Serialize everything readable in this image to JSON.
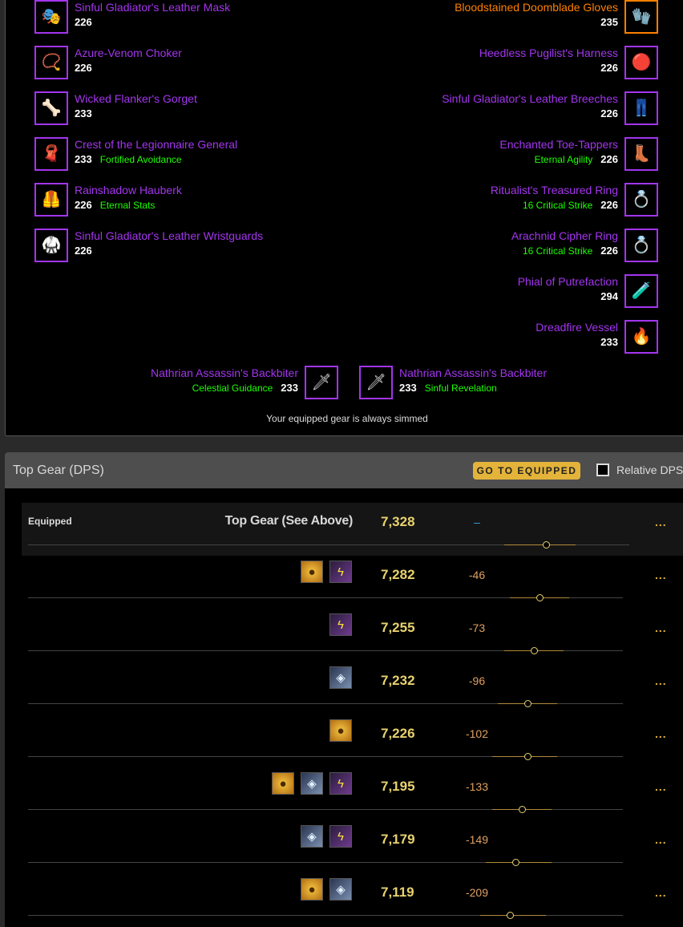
{
  "gear": {
    "left": [
      {
        "name": "Sinful Gladiator's Leather Mask",
        "ilvl": "226",
        "enchant": "",
        "icon": "leather-mask-icon",
        "glyph": "🎭"
      },
      {
        "name": "Azure-Venom Choker",
        "ilvl": "226",
        "enchant": "",
        "icon": "choker-icon",
        "glyph": "📿"
      },
      {
        "name": "Wicked Flanker's Gorget",
        "ilvl": "233",
        "enchant": "",
        "icon": "gorget-icon",
        "glyph": "🦴"
      },
      {
        "name": "Crest of the Legionnaire General",
        "ilvl": "233",
        "enchant": "Fortified Avoidance",
        "icon": "cloak-icon",
        "glyph": "🧣"
      },
      {
        "name": "Rainshadow Hauberk",
        "ilvl": "226",
        "enchant": "Eternal Stats",
        "icon": "chest-armor-icon",
        "glyph": "🦺"
      },
      {
        "name": "Sinful Gladiator's Leather Wristguards",
        "ilvl": "226",
        "enchant": "",
        "icon": "wristguards-icon",
        "glyph": "🥋"
      }
    ],
    "right": [
      {
        "name": "Bloodstained Doomblade Gloves",
        "ilvl": "235",
        "enchant": "",
        "icon": "gloves-icon",
        "glyph": "🧤",
        "legendary": true
      },
      {
        "name": "Heedless Pugilist's Harness",
        "ilvl": "226",
        "enchant": "",
        "icon": "belt-icon",
        "glyph": "🔴"
      },
      {
        "name": "Sinful Gladiator's Leather Breeches",
        "ilvl": "226",
        "enchant": "",
        "icon": "pants-icon",
        "glyph": "👖"
      },
      {
        "name": "Enchanted Toe-Tappers",
        "ilvl": "226",
        "enchant": "Eternal Agility",
        "icon": "boots-icon",
        "glyph": "👢"
      },
      {
        "name": "Ritualist's Treasured Ring",
        "ilvl": "226",
        "enchant": "16 Critical Strike",
        "icon": "ring-icon",
        "glyph": "💍"
      },
      {
        "name": "Arachnid Cipher Ring",
        "ilvl": "226",
        "enchant": "16 Critical Strike",
        "icon": "ring-icon",
        "glyph": "💍"
      },
      {
        "name": "Phial of Putrefaction",
        "ilvl": "294",
        "enchant": "",
        "icon": "trinket-icon",
        "glyph": "🧪"
      },
      {
        "name": "Dreadfire Vessel",
        "ilvl": "233",
        "enchant": "",
        "icon": "trinket-icon",
        "glyph": "🔥"
      }
    ],
    "weapons": [
      {
        "name": "Nathrian Assassin's Backbiter",
        "ilvl": "233",
        "enchant": "Celestial Guidance",
        "icon": "dagger-icon",
        "glyph": "🗡"
      },
      {
        "name": "Nathrian Assassin's Backbiter",
        "ilvl": "233",
        "enchant": "Sinful Revelation",
        "icon": "dagger-icon",
        "glyph": "🗡"
      }
    ],
    "note": "Your equipped gear is always simmed"
  },
  "top_gear": {
    "title": "Top Gear (DPS)",
    "goto_label": "GO TO EQUIPPED",
    "relative_label": "Relative DPS",
    "equipped_label": "Equipped",
    "equipped_title": "Top Gear (See Above)",
    "more_label": "...",
    "rows": [
      {
        "dps": "7,328",
        "diff": "–",
        "items": [],
        "dot": 0.87,
        "lo": 0.8,
        "hi": 0.92
      },
      {
        "dps": "7,282",
        "diff": "-46",
        "items": [
          "vessel",
          "hood"
        ],
        "dot": 0.86,
        "lo": 0.81,
        "hi": 0.91
      },
      {
        "dps": "7,255",
        "diff": "-73",
        "items": [
          "hood"
        ],
        "dot": 0.85,
        "lo": 0.8,
        "hi": 0.9
      },
      {
        "dps": "7,232",
        "diff": "-96",
        "items": [
          "ring"
        ],
        "dot": 0.84,
        "lo": 0.79,
        "hi": 0.89
      },
      {
        "dps": "7,226",
        "diff": "-102",
        "items": [
          "vessel"
        ],
        "dot": 0.84,
        "lo": 0.78,
        "hi": 0.89
      },
      {
        "dps": "7,195",
        "diff": "-133",
        "items": [
          "vessel",
          "ring",
          "hood"
        ],
        "dot": 0.83,
        "lo": 0.78,
        "hi": 0.88
      },
      {
        "dps": "7,179",
        "diff": "-149",
        "items": [
          "ring",
          "hood"
        ],
        "dot": 0.82,
        "lo": 0.77,
        "hi": 0.88
      },
      {
        "dps": "7,119",
        "diff": "-209",
        "items": [
          "vessel",
          "ring"
        ],
        "dot": 0.81,
        "lo": 0.76,
        "hi": 0.87
      }
    ],
    "icon_names": {
      "vessel": "dreadfire-vessel-icon",
      "hood": "hood-icon",
      "ring": "cipher-ring-icon"
    },
    "icon_glyphs": {
      "vessel": "●",
      "hood": "ϟ",
      "ring": "◈"
    }
  }
}
